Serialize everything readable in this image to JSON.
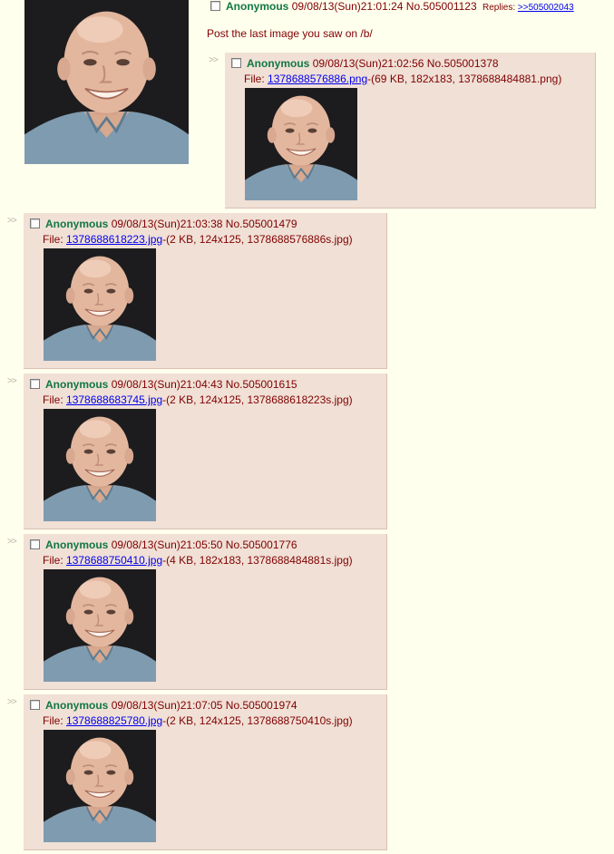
{
  "op": {
    "name": "Anonymous",
    "datetime": "09/08/13(Sun)21:01:24",
    "postnum": "No.505001123",
    "replies_label": "Replies:",
    "replies_link": ">>505002043",
    "comment": "Post the last image you saw on /b/",
    "image_icon": "bald-man-photo"
  },
  "arrows": ">>",
  "file_prefix": "File:",
  "replies": [
    {
      "name": "Anonymous",
      "datetime": "09/08/13(Sun)21:02:56",
      "postnum": "No.505001378",
      "file_link": "1378688576886.png",
      "file_info": "-(69 KB, 182x183, 1378688484881.png)"
    },
    {
      "name": "Anonymous",
      "datetime": "09/08/13(Sun)21:03:38",
      "postnum": "No.505001479",
      "file_link": "1378688618223.jpg",
      "file_info": "-(2 KB, 124x125, 1378688576886s.jpg)"
    },
    {
      "name": "Anonymous",
      "datetime": "09/08/13(Sun)21:04:43",
      "postnum": "No.505001615",
      "file_link": "1378688683745.jpg",
      "file_info": "-(2 KB, 124x125, 1378688618223s.jpg)"
    },
    {
      "name": "Anonymous",
      "datetime": "09/08/13(Sun)21:05:50",
      "postnum": "No.505001776",
      "file_link": "1378688750410.jpg",
      "file_info": "-(4 KB, 182x183, 1378688484881s.jpg)"
    },
    {
      "name": "Anonymous",
      "datetime": "09/08/13(Sun)21:07:05",
      "postnum": "No.505001974",
      "file_link": "1378688825780.jpg",
      "file_info": "-(2 KB, 124x125, 1378688750410s.jpg)"
    }
  ],
  "colors": {
    "background": "#FFFFEE",
    "reply_background": "#F0E0D6",
    "name": "#117743",
    "text": "#800000",
    "link": "#0000EE"
  }
}
